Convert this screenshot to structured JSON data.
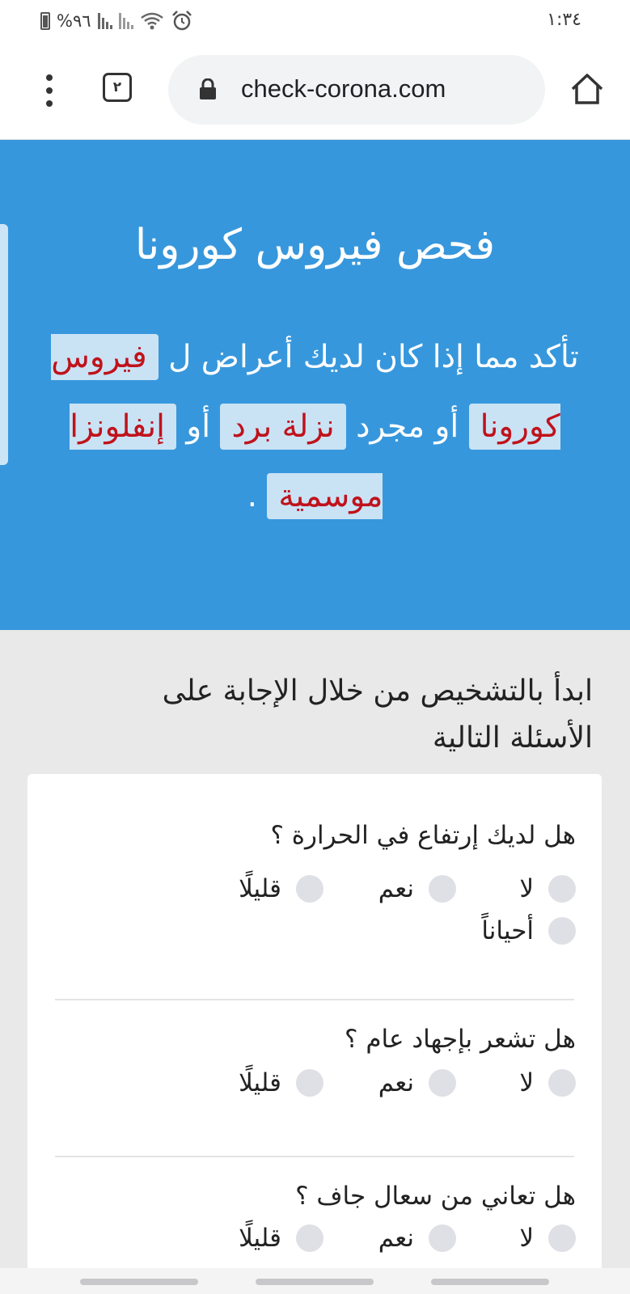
{
  "status_bar": {
    "time": "١:٣٤",
    "battery": "%٩٦"
  },
  "browser": {
    "url": "check-corona.com",
    "tab_count": "٢"
  },
  "hero": {
    "title": "فحص فيروس كورونا",
    "line_start": "تأكد مما إذا كان لديك أعراض ل",
    "highlight_corona": "فيروس كورونا",
    "or_just": "أو مجرد",
    "highlight_cold": "نزلة برد",
    "or": "أو",
    "highlight_flu": "إنفلونزا موسمية",
    "end": "."
  },
  "intro_text": "ابدأ بالتشخيص من خلال الإجابة على الأسئلة التالية",
  "questions": [
    {
      "text": "هل لديك إرتفاع في الحرارة ؟",
      "options": [
        "لا",
        "نعم",
        "قليلًا",
        "أحياناً"
      ]
    },
    {
      "text": "هل تشعر بإجهاد عام ؟",
      "options": [
        "لا",
        "نعم",
        "قليلًا"
      ]
    },
    {
      "text": "هل تعاني من سعال جاف ؟",
      "options": [
        "لا",
        "نعم",
        "قليلًا"
      ]
    }
  ],
  "colors": {
    "hero_bg": "#3797dc",
    "highlight_bg": "#c9e3f5",
    "highlight_text": "#c0121b",
    "page_bg": "#e9e9ea"
  }
}
